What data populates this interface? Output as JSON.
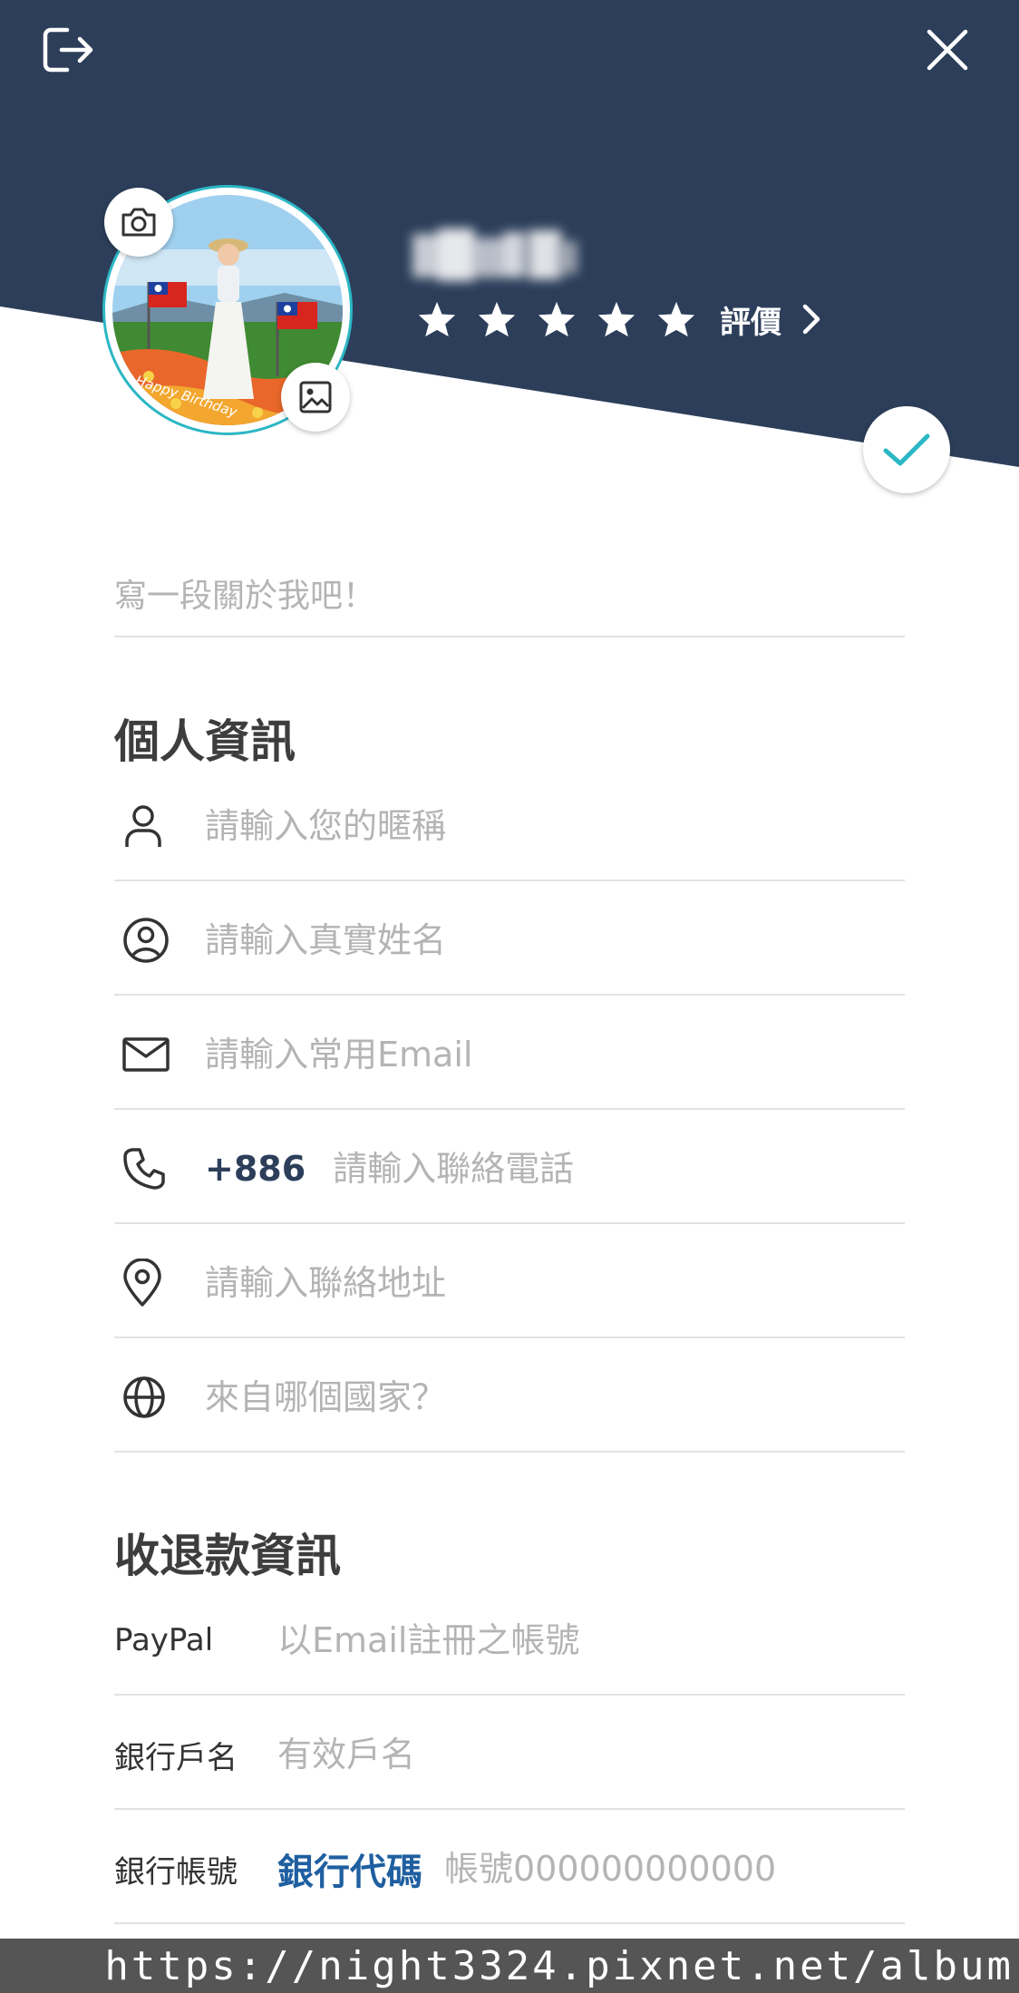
{
  "header": {
    "rating_label": "評價",
    "star_count": 5,
    "avatar_caption": "Happy Birthday"
  },
  "about": {
    "placeholder": "寫一段關於我吧！"
  },
  "personal": {
    "title": "個人資訊",
    "nickname_placeholder": "請輸入您的暱稱",
    "realname_placeholder": "請輸入真實姓名",
    "email_placeholder": "請輸入常用Email",
    "phone_prefix": "+886",
    "phone_placeholder": "請輸入聯絡電話",
    "address_placeholder": "請輸入聯絡地址",
    "country_placeholder": "來自哪個國家？"
  },
  "payment": {
    "title": "收退款資訊",
    "paypal_label": "PayPal",
    "paypal_placeholder": "以Email註冊之帳號",
    "bank_name_label": "銀行戶名",
    "bank_name_placeholder": "有效戶名",
    "bank_account_label": "銀行帳號",
    "bank_code_label": "銀行代碼",
    "bank_account_placeholder": "帳號000000000000"
  },
  "watermark": {
    "text": "https://night3324.pixnet.net/album"
  },
  "colors": {
    "header_bg": "#2c3e5a",
    "accent": "#2bb7c4",
    "bank_code": "#1f5fa0"
  }
}
